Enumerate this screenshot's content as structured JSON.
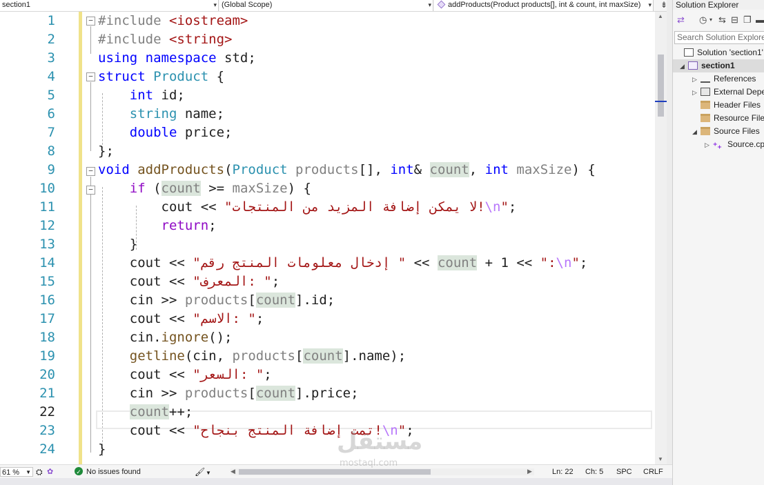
{
  "navbar": {
    "project": "section1",
    "scope": "(Global Scope)",
    "member": "addProducts(Product products[], int & count, int maxSize)",
    "split_glyph": "⇟"
  },
  "editor": {
    "line_numbers": [
      "1",
      "2",
      "3",
      "4",
      "5",
      "6",
      "7",
      "8",
      "9",
      "10",
      "11",
      "12",
      "13",
      "14",
      "15",
      "16",
      "17",
      "18",
      "19",
      "20",
      "21",
      "22",
      "23",
      "24"
    ],
    "current_line": "22",
    "tokens": {
      "l1": {
        "a": "#include ",
        "b": "<iostream>"
      },
      "l2": {
        "a": "#include ",
        "b": "<string>"
      },
      "l3": {
        "a": "using",
        "b": " ",
        "c": "namespace",
        "d": " std;"
      },
      "l4": {
        "a": "struct",
        "b": " ",
        "c": "Product",
        "d": " {"
      },
      "l5": {
        "a": "    ",
        "b": "int",
        "c": " id;"
      },
      "l6": {
        "a": "    ",
        "b": "string",
        "c": " name;"
      },
      "l7": {
        "a": "    ",
        "b": "double",
        "c": " price;"
      },
      "l8": {
        "a": "};"
      },
      "l9": {
        "a": "void",
        "b": " ",
        "c": "addProducts",
        "d": "(",
        "e": "Product",
        "f": " ",
        "g": "products",
        "h": "[], ",
        "i": "int",
        "j": "& ",
        "k": "count",
        "l": ", ",
        "m": "int",
        "n": " ",
        "o": "maxSize",
        "p": ") {"
      },
      "l10": {
        "a": "    ",
        "b": "if",
        "c": " (",
        "d": "count",
        "e": " >= ",
        "f": "maxSize",
        "g": ") {"
      },
      "l11": {
        "a": "        cout << ",
        "b": "\"لا يمكن إضافة المزيد من المنتجات!",
        "c": "\\n",
        "d": "\"",
        "e": ";"
      },
      "l12": {
        "a": "        ",
        "b": "return",
        "c": ";"
      },
      "l13": {
        "a": "    }"
      },
      "l14": {
        "a": "    cout << ",
        "b": "\"إدخال معلومات المنتج رقم \"",
        "c": " << ",
        "d": "count",
        "e": " + 1 << ",
        "f": "\":",
        "g": "\\n",
        "h": "\"",
        "i": ";"
      },
      "l15": {
        "a": "    cout << ",
        "b": "\"المعرف: \"",
        "c": ";"
      },
      "l16": {
        "a": "    cin >> ",
        "b": "products",
        "c": "[",
        "d": "count",
        "e": "].id;"
      },
      "l17": {
        "a": "    cout << ",
        "b": "\"الاسم: \"",
        "c": ";"
      },
      "l18": {
        "a": "    cin.",
        "b": "ignore",
        "c": "();"
      },
      "l19": {
        "a": "    ",
        "b": "getline",
        "c": "(cin, ",
        "d": "products",
        "e": "[",
        "f": "count",
        "g": "].name);"
      },
      "l20": {
        "a": "    cout << ",
        "b": "\"السعر: \"",
        "c": ";"
      },
      "l21": {
        "a": "    cin >> ",
        "b": "products",
        "c": "[",
        "d": "count",
        "e": "].price;"
      },
      "l22": {
        "a": "    ",
        "b": "count",
        "c": "++;"
      },
      "l23": {
        "a": "    cout << ",
        "b": "\"تمت إضافة المنتج بنجاح!",
        "c": "\\n",
        "d": "\"",
        "e": ";"
      },
      "l24": {
        "a": "}"
      }
    }
  },
  "status": {
    "zoom": "61 %",
    "issues_glyph": "✓",
    "issues": "No issues found",
    "line": "Ln: 22",
    "col": "Ch: 5",
    "mode": "SPC",
    "eol": "CRLF"
  },
  "solution_explorer": {
    "title": "Solution Explorer",
    "search_placeholder": "Search Solution Explorer",
    "nodes": {
      "solution": "Solution 'section1'",
      "project": "section1",
      "references": "References",
      "external": "External Dependencies",
      "header": "Header Files",
      "resource": "Resource Files",
      "source": "Source Files",
      "source_file": "Source.cpp"
    }
  },
  "watermark": {
    "text": "مستقل",
    "url": "mostaql.com"
  },
  "colors": {
    "keyword": "#0000ff",
    "type": "#2b91af",
    "string": "#a31515",
    "control": "#8f08c4",
    "function": "#74531f",
    "line_number": "#2b91af"
  }
}
